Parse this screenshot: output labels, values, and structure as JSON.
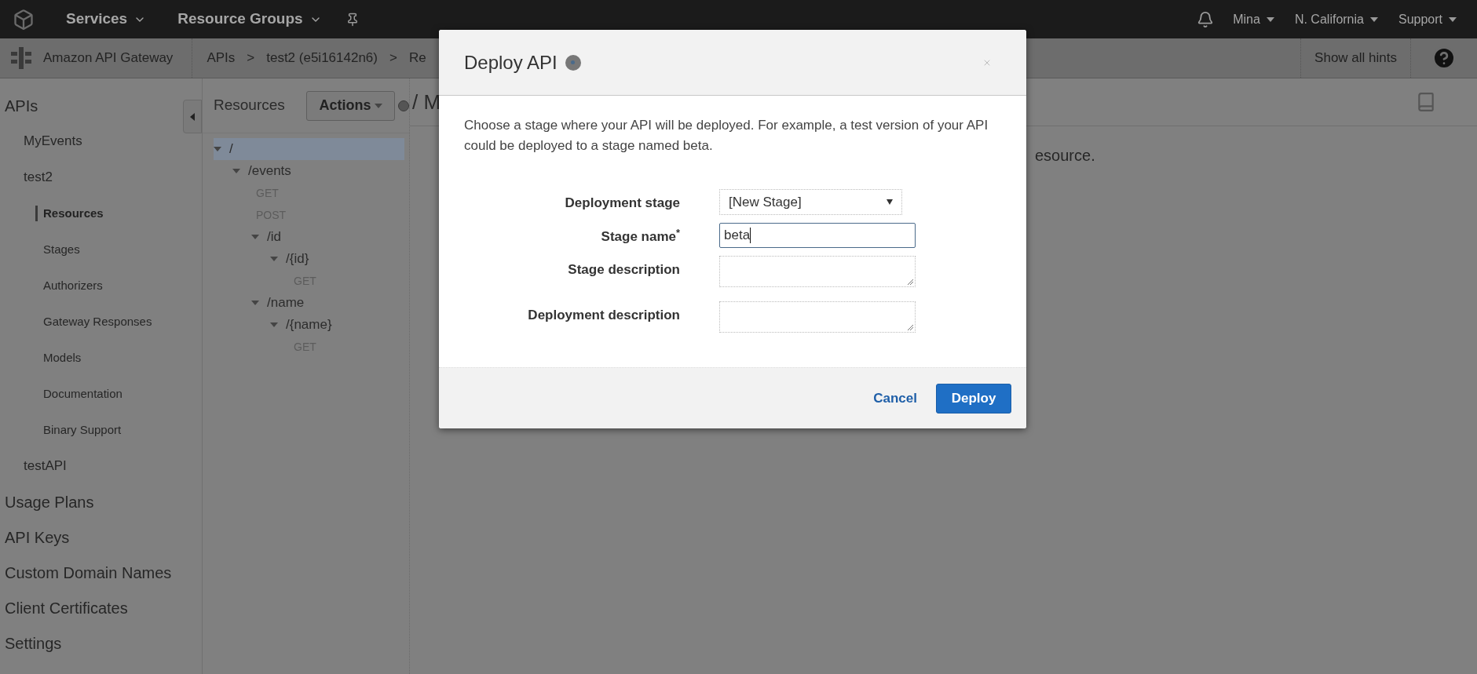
{
  "topbar": {
    "menus": [
      {
        "label": "Services"
      },
      {
        "label": "Resource Groups"
      }
    ],
    "user_menus": [
      {
        "label": "Mina"
      },
      {
        "label": "N. California"
      },
      {
        "label": "Support"
      }
    ]
  },
  "breadcrumb_bar": {
    "service": "Amazon API Gateway",
    "crumbs": [
      "APIs",
      "test2 (e5i16142n6)",
      "Re"
    ],
    "separator": ">",
    "hints_button": "Show all hints"
  },
  "sidebar": {
    "items": [
      {
        "label": "APIs",
        "selected": false,
        "children": [
          {
            "label": "MyEvents",
            "selected": false
          },
          {
            "label": "test2",
            "selected": false,
            "children": [
              {
                "label": "Resources",
                "selected": true
              },
              {
                "label": "Stages",
                "selected": false
              },
              {
                "label": "Authorizers",
                "selected": false
              },
              {
                "label": "Gateway Responses",
                "selected": false
              },
              {
                "label": "Models",
                "selected": false
              },
              {
                "label": "Documentation",
                "selected": false
              },
              {
                "label": "Binary Support",
                "selected": false
              }
            ]
          },
          {
            "label": "testAPI",
            "selected": false
          }
        ]
      },
      {
        "label": "Usage Plans",
        "selected": false
      },
      {
        "label": "API Keys",
        "selected": false
      },
      {
        "label": "Custom Domain Names",
        "selected": false
      },
      {
        "label": "Client Certificates",
        "selected": false
      },
      {
        "label": "Settings",
        "selected": false
      }
    ]
  },
  "resources_panel": {
    "title": "Resources",
    "actions_button": "Actions",
    "tree": [
      {
        "kind": "resource",
        "label": "/",
        "selected": true,
        "expanded": true,
        "children": [
          {
            "kind": "resource",
            "label": "/events",
            "selected": false,
            "expanded": true,
            "children": [
              {
                "kind": "method",
                "label": "GET",
                "selected": false
              },
              {
                "kind": "method",
                "label": "POST",
                "selected": false
              },
              {
                "kind": "resource",
                "label": "/id",
                "selected": false,
                "expanded": true,
                "children": [
                  {
                    "kind": "resource",
                    "label": "/{id}",
                    "selected": false,
                    "expanded": true,
                    "children": [
                      {
                        "kind": "method",
                        "label": "GET",
                        "selected": false
                      }
                    ]
                  }
                ]
              },
              {
                "kind": "resource",
                "label": "/name",
                "selected": false,
                "expanded": true,
                "children": [
                  {
                    "kind": "resource",
                    "label": "/{name}",
                    "selected": false,
                    "expanded": true,
                    "children": [
                      {
                        "kind": "method",
                        "label": "GET",
                        "selected": false
                      }
                    ]
                  }
                ]
              }
            ]
          }
        ]
      }
    ]
  },
  "main": {
    "heading": "/ M",
    "message": "esource."
  },
  "modal": {
    "title": "Deploy API",
    "description": "Choose a stage where your API will be deployed. For example, a test version of your API could be deployed to a stage named beta.",
    "fields": [
      {
        "kind": "select",
        "label": "Deployment stage",
        "value": "[New Stage]"
      },
      {
        "kind": "input",
        "label": "Stage name$^{*}$",
        "value": "beta"
      },
      {
        "kind": "textarea",
        "label": "Stage description"
      },
      {
        "kind": "textarea",
        "label": "Deployment description"
      }
    ],
    "buttons": [
      {
        "kind": "link",
        "label": "Cancel"
      },
      {
        "kind": "primary",
        "label": "Deploy"
      }
    ]
  }
}
